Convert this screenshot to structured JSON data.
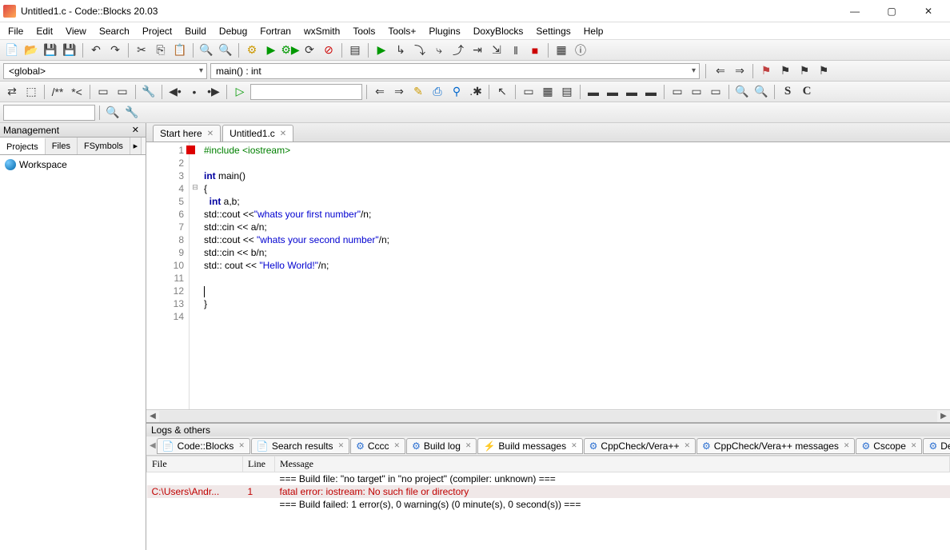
{
  "window": {
    "title": "Untitled1.c - Code::Blocks 20.03"
  },
  "menu": [
    "File",
    "Edit",
    "View",
    "Search",
    "Project",
    "Build",
    "Debug",
    "Fortran",
    "wxSmith",
    "Tools",
    "Tools+",
    "Plugins",
    "DoxyBlocks",
    "Settings",
    "Help"
  ],
  "scope": {
    "global": "<global>",
    "func": "main() : int"
  },
  "management": {
    "title": "Management",
    "tabs": [
      "Projects",
      "Files",
      "FSymbols"
    ],
    "workspace": "Workspace"
  },
  "editor_tabs": [
    {
      "label": "Start here"
    },
    {
      "label": "Untitled1.c"
    }
  ],
  "code_lines": [
    {
      "n": 1,
      "mark": true,
      "tokens": [
        [
          "kw-green",
          "#include "
        ],
        [
          "kw-green",
          "<iostream>"
        ]
      ]
    },
    {
      "n": 2,
      "tokens": []
    },
    {
      "n": 3,
      "tokens": [
        [
          "kw-blue",
          "int"
        ],
        [
          "",
          " main"
        ],
        [
          "",
          "()"
        ]
      ]
    },
    {
      "n": 4,
      "fold": true,
      "tokens": [
        [
          "",
          "{"
        ]
      ]
    },
    {
      "n": 5,
      "tokens": [
        [
          "",
          "  "
        ],
        [
          "kw-blue",
          "int"
        ],
        [
          "",
          " a,b;"
        ]
      ]
    },
    {
      "n": 6,
      "tokens": [
        [
          "",
          "std::cout <<"
        ],
        [
          "str",
          "\"whats your first number\""
        ],
        [
          "",
          "/n;"
        ]
      ]
    },
    {
      "n": 7,
      "tokens": [
        [
          "",
          "std::cin << a/n;"
        ]
      ]
    },
    {
      "n": 8,
      "tokens": [
        [
          "",
          "std::cout << "
        ],
        [
          "str",
          "\"whats your second number\""
        ],
        [
          "",
          "/n;"
        ]
      ]
    },
    {
      "n": 9,
      "tokens": [
        [
          "",
          "std::cin << b/n;"
        ]
      ]
    },
    {
      "n": 10,
      "tokens": [
        [
          "",
          "std:: cout << "
        ],
        [
          "str",
          "\"Hello World!\""
        ],
        [
          "",
          "/n;"
        ]
      ]
    },
    {
      "n": 11,
      "tokens": []
    },
    {
      "n": 12,
      "cursor": true,
      "tokens": []
    },
    {
      "n": 13,
      "tokens": [
        [
          "",
          "}"
        ]
      ]
    },
    {
      "n": 14,
      "tokens": []
    }
  ],
  "logs": {
    "title": "Logs & others",
    "tabs": [
      "Code::Blocks",
      "Search results",
      "Cccc",
      "Build log",
      "Build messages",
      "CppCheck/Vera++",
      "CppCheck/Vera++ messages",
      "Cscope",
      "Debugg"
    ],
    "active_tab": 4,
    "gear_tabs": [
      2,
      3,
      5,
      6,
      7,
      8
    ],
    "bolt_tabs": [
      4
    ],
    "headers": [
      "File",
      "Line",
      "Message"
    ],
    "rows": [
      {
        "file": "",
        "line": "",
        "msg": "=== Build file: \"no target\" in \"no project\" (compiler: unknown) ==="
      },
      {
        "file": "C:\\Users\\Andr...",
        "line": "1",
        "msg": "fatal error: iostream: No such file or directory",
        "err": true
      },
      {
        "file": "",
        "line": "",
        "msg": "=== Build failed: 1 error(s), 0 warning(s) (0 minute(s), 0 second(s)) ==="
      }
    ]
  }
}
